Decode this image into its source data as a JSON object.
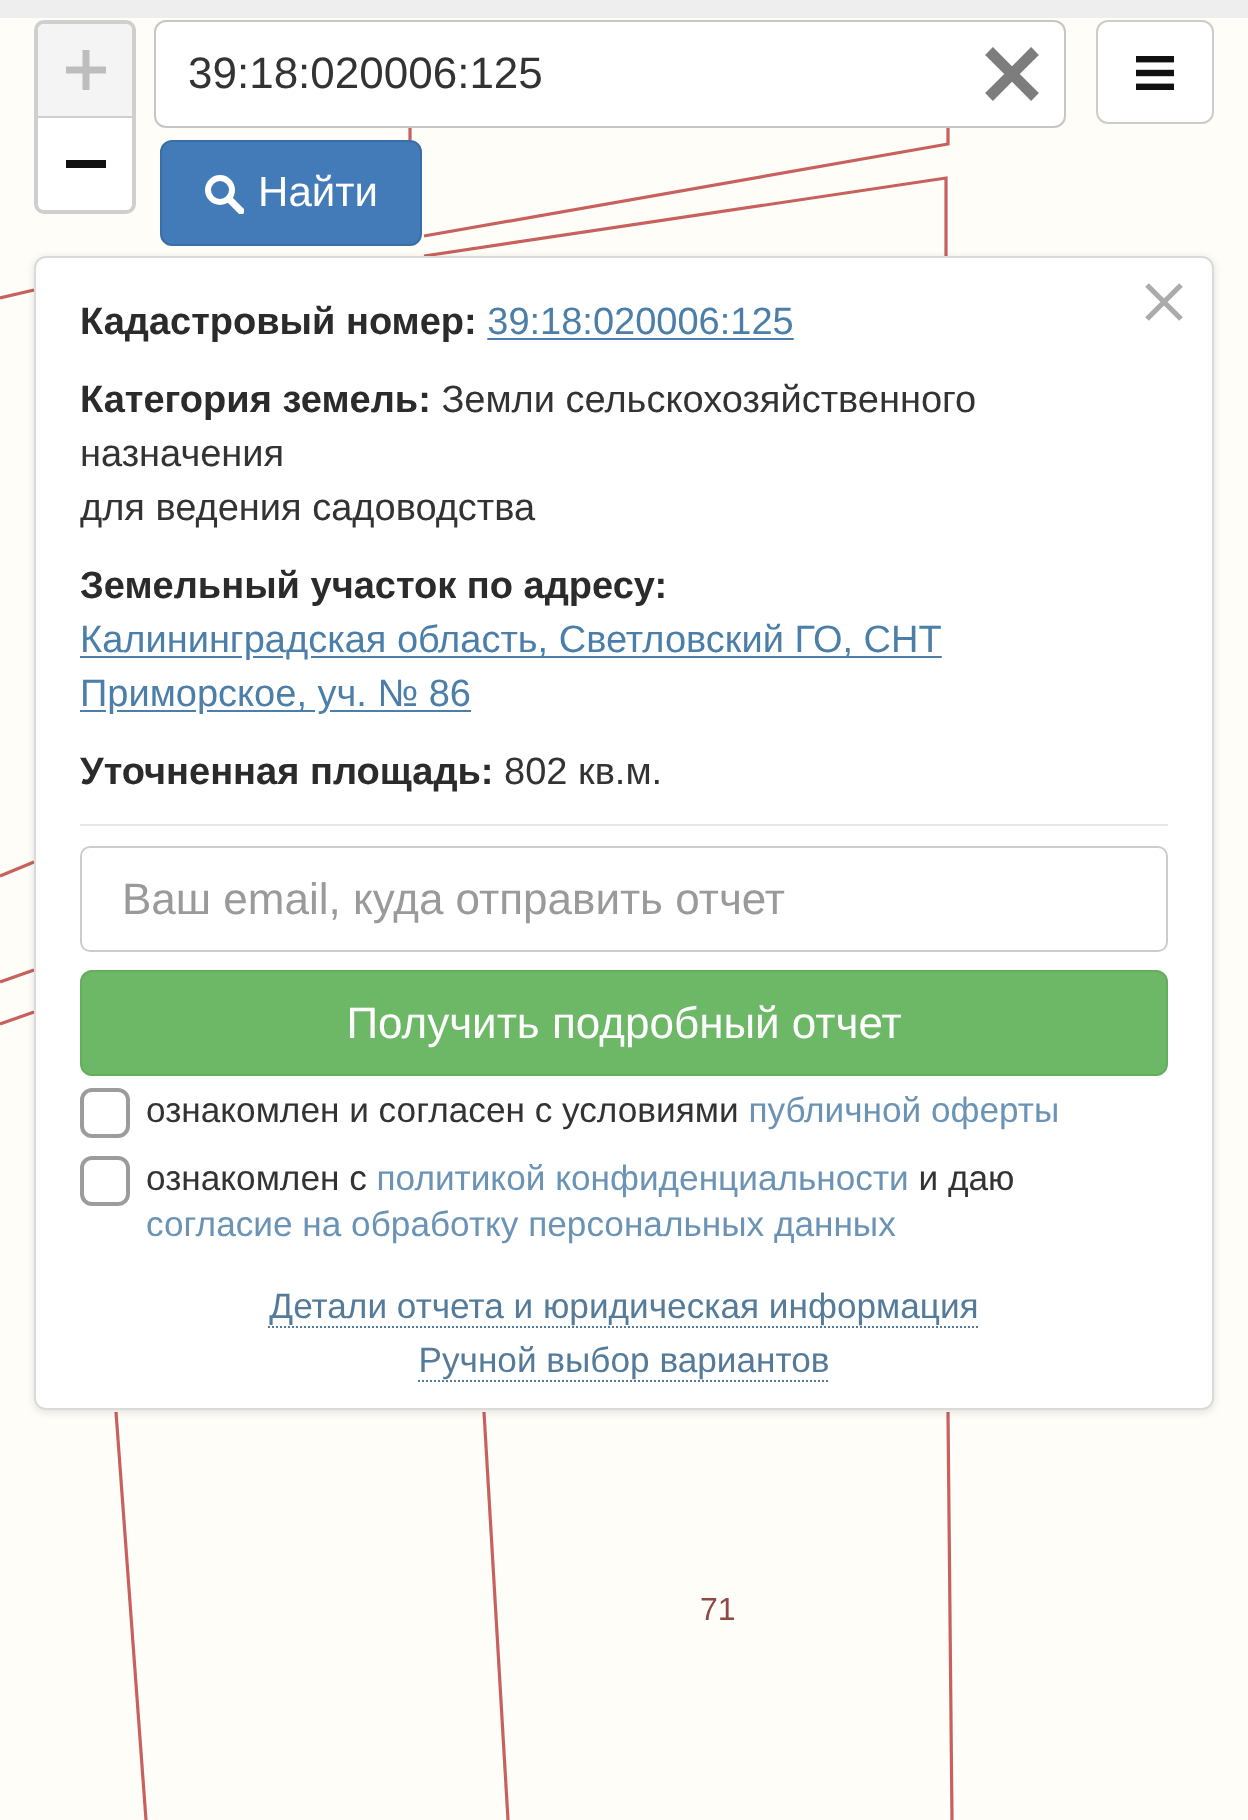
{
  "map": {
    "parcel_label": "71"
  },
  "map_controls": {
    "zoom_in": {
      "disabled": true
    },
    "zoom_out": {
      "disabled": false
    }
  },
  "search": {
    "value": "39:18:020006:125",
    "button": "Найти"
  },
  "popup": {
    "fields": [
      {
        "label": "Кадастровый номер:",
        "kind": "link",
        "value": "39:18:020006:125"
      },
      {
        "label": "Категория земель:",
        "kind": "text",
        "lines": [
          "Земли сельскохозяйственного назначения",
          "для ведения садоводства"
        ]
      },
      {
        "label": "Земельный участок по адресу:",
        "kind": "link",
        "value": "Калининградская область, Светловский ГО, СНТ Приморское, уч. № 86"
      },
      {
        "label": "Уточненная площадь:",
        "kind": "text",
        "lines": [
          "802 кв.м."
        ]
      }
    ],
    "email": {
      "placeholder": "Ваш email, куда отправить отчет"
    },
    "submit": "Получить подробный отчет",
    "consents": [
      {
        "checked": false,
        "parts": [
          {
            "kind": "text",
            "text": "ознакомлен и согласен с условиями"
          },
          {
            "kind": "link",
            "text": "публичной оферты"
          }
        ]
      },
      {
        "checked": false,
        "parts": [
          {
            "kind": "text",
            "text": "ознакомлен с"
          },
          {
            "kind": "link",
            "text": "политикой конфиденциальности"
          },
          {
            "kind": "text",
            "text": "и даю"
          },
          {
            "kind": "link",
            "text": "согласие на обработку персональных данных"
          }
        ]
      }
    ],
    "footer_links": [
      "Детали отчета и юридическая информация",
      "Ручной выбор вариантов"
    ]
  }
}
